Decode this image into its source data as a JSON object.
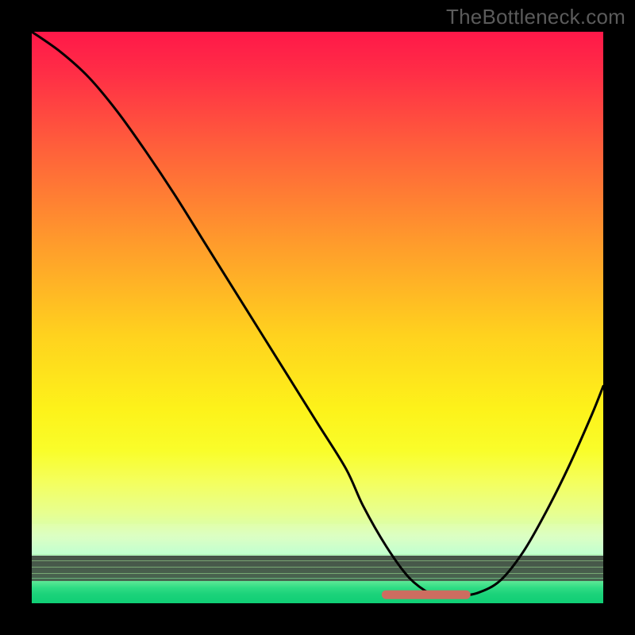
{
  "watermark": "TheBottleneck.com",
  "chart_data": {
    "type": "line",
    "title": "",
    "xlabel": "",
    "ylabel": "",
    "xlim": [
      0,
      100
    ],
    "ylim": [
      0,
      100
    ],
    "grid": false,
    "legend": false,
    "series": [
      {
        "name": "curve",
        "x": [
          0,
          5,
          10,
          15,
          20,
          25,
          30,
          35,
          40,
          45,
          50,
          55,
          58,
          62,
          66,
          70,
          72,
          74,
          78,
          82,
          86,
          90,
          94,
          98,
          100
        ],
        "y": [
          100,
          96.5,
          92,
          86,
          79,
          71.5,
          63.5,
          55.5,
          47.5,
          39.5,
          31.5,
          23.5,
          17,
          10,
          4.5,
          1.5,
          1.2,
          1.2,
          1.8,
          4,
          9,
          16,
          24,
          33,
          38
        ]
      },
      {
        "name": "flat-marker",
        "x": [
          62,
          76
        ],
        "y": [
          1.5,
          1.5
        ]
      }
    ],
    "background_bands": [
      {
        "name": "red-to-yellow-gradient",
        "from_y": 8,
        "to_y": 100
      },
      {
        "name": "pale-transition",
        "from_y": 4,
        "to_y": 14
      },
      {
        "name": "green-band",
        "from_y": 0,
        "to_y": 4
      }
    ]
  }
}
